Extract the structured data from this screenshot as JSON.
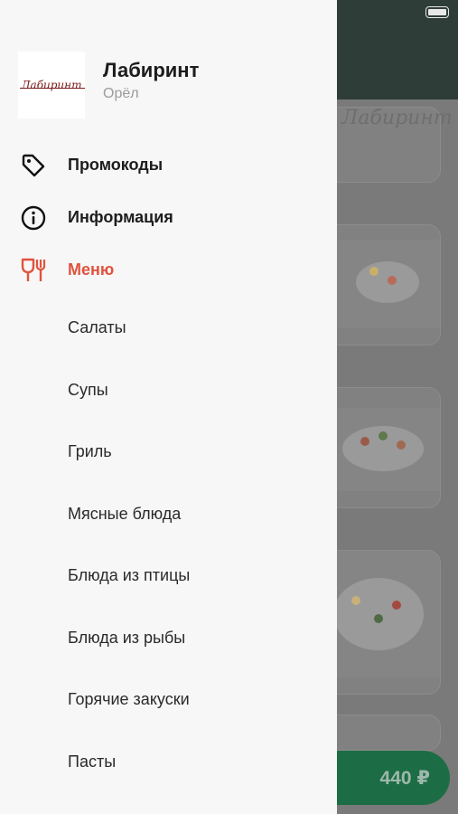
{
  "restaurant": {
    "name": "Лабиринт",
    "city": "Орёл",
    "logo_text": "Лабиринт"
  },
  "nav": {
    "promocodes": "Промокоды",
    "info": "Информация",
    "menu": "Меню"
  },
  "menu_categories": [
    "Салаты",
    "Супы",
    "Гриль",
    "Мясные блюда",
    "Блюда из птицы",
    "Блюда из рыбы",
    "Горячие закуски",
    "Пасты"
  ],
  "cart": {
    "total": "440 ₽"
  },
  "colors": {
    "accent": "#e0533e",
    "cart": "#1c6d45"
  }
}
